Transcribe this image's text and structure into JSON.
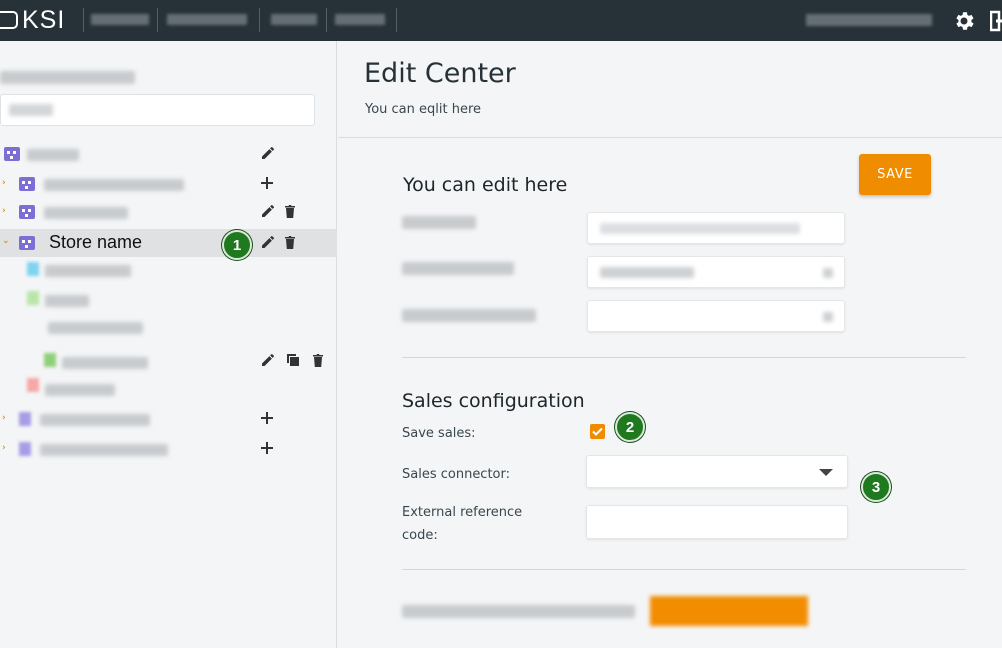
{
  "app": {
    "logo_text": "KSI"
  },
  "tree": {
    "selected_item_label": "Store name",
    "badge_1": "1"
  },
  "main": {
    "title": "Edit Center",
    "subtitle": "You can eqlit here",
    "save_label": "SAVE",
    "section1_title": "You can edit here",
    "sales": {
      "title": "Sales configuration",
      "save_sales_label": "Save sales:",
      "save_sales_checked": true,
      "connector_label": "Sales connector:",
      "connector_value": "",
      "external_ref_label_line1": "External reference",
      "external_ref_label_line2": "code:",
      "external_ref_value": ""
    },
    "badge_2": "2",
    "badge_3": "3"
  },
  "colors": {
    "accent": "#f08c00",
    "topbar": "#263238",
    "badge": "#1f7a1f",
    "tree_icon": "#7b6fd6"
  },
  "icons": [
    "gear-icon",
    "logout-icon",
    "pencil-icon",
    "trash-icon",
    "plus-icon",
    "copy-icon",
    "building-icon",
    "chevron-right-icon",
    "chevron-down-icon",
    "dropdown-caret-icon",
    "check-icon"
  ]
}
